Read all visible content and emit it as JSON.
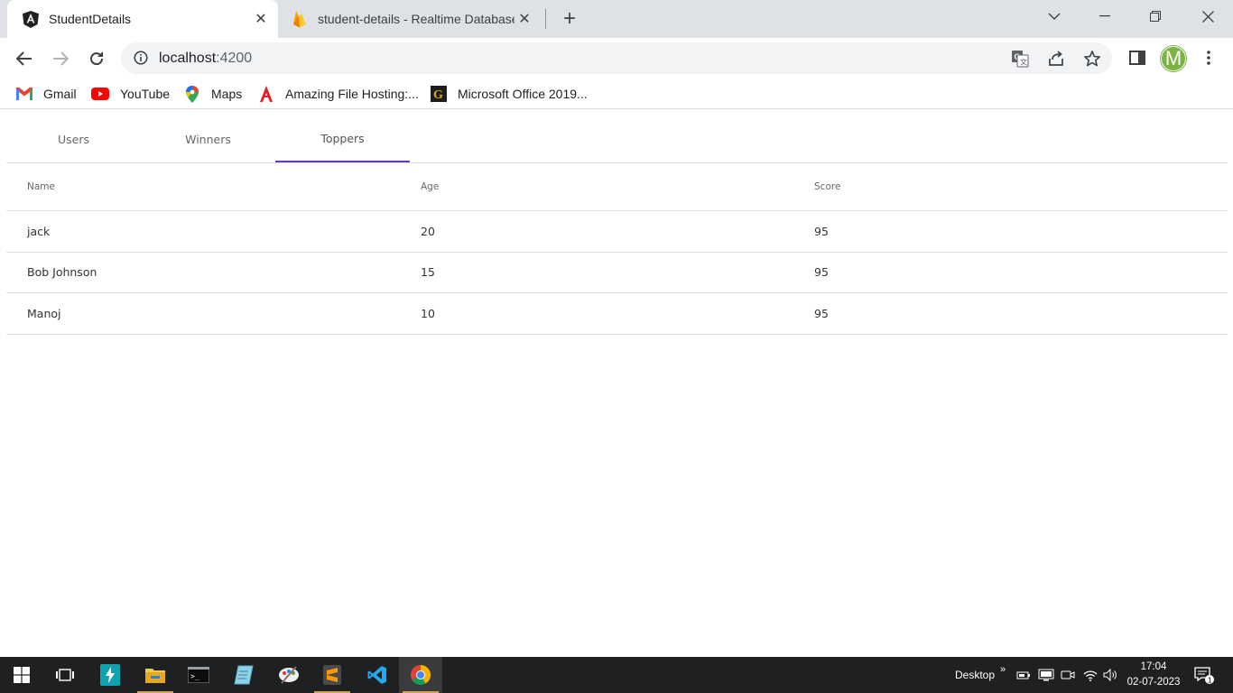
{
  "browser": {
    "tabs": [
      {
        "title": "StudentDetails",
        "favicon": "angular-icon",
        "active": true
      },
      {
        "title": "student-details - Realtime Database",
        "favicon": "firebase-icon",
        "active": false
      }
    ],
    "url_host": "localhost",
    "url_port": ":4200",
    "avatar_letter": "M",
    "bookmarks": [
      {
        "label": "Gmail",
        "icon": "gmail-icon"
      },
      {
        "label": "YouTube",
        "icon": "youtube-icon"
      },
      {
        "label": "Maps",
        "icon": "maps-icon"
      },
      {
        "label": "Amazing File Hosting:...",
        "icon": "adobe-icon"
      },
      {
        "label": "Microsoft Office 2019...",
        "icon": "office-g-icon"
      }
    ]
  },
  "app": {
    "tabs": [
      {
        "label": "Users",
        "selected": false
      },
      {
        "label": "Winners",
        "selected": false
      },
      {
        "label": "Toppers",
        "selected": true
      }
    ],
    "table": {
      "columns": [
        "Name",
        "Age",
        "Score"
      ],
      "rows": [
        [
          "jack",
          "20",
          "95"
        ],
        [
          "Bob Johnson",
          "15",
          "95"
        ],
        [
          "Manoj",
          "10",
          "95"
        ]
      ]
    },
    "accent_color": "#673ab7"
  },
  "taskbar": {
    "desktop_label": "Desktop",
    "time": "17:04",
    "date": "02-07-2023",
    "notification_count": "1"
  }
}
